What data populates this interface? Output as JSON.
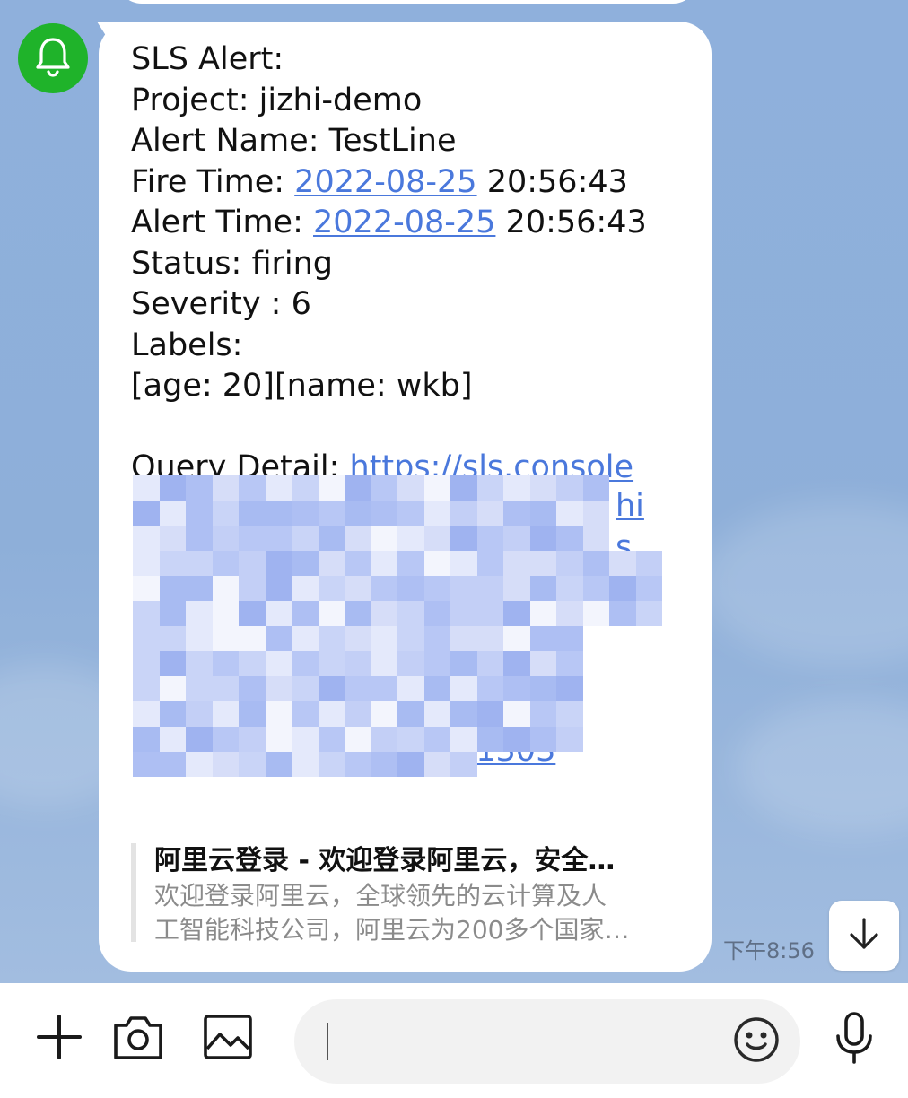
{
  "message": {
    "lines": [
      {
        "text": "SLS Alert:"
      },
      {
        "text": "Project: jizhi-demo"
      },
      {
        "text": "Alert Name: TestLine"
      },
      {
        "prefix": "Fire Time: ",
        "link": "2022-08-25",
        "suffix": " 20:56:43"
      },
      {
        "prefix": "Alert Time: ",
        "link": "2022-08-25",
        "suffix": " 20:56:43"
      },
      {
        "text": "Status: firing"
      },
      {
        "text": "Severity : 6"
      },
      {
        "text": "Labels:"
      },
      {
        "text": "[age: 20][name: wkb]"
      },
      {
        "text": ""
      },
      {
        "prefix": "Query Detail: ",
        "link": "https://sls.console"
      }
    ],
    "url_fragments": [
      "hi",
      "s",
      "e",
      "31303"
    ]
  },
  "link_preview": {
    "title": "阿里云登录 - 欢迎登录阿里云，安全…",
    "description_line1": "欢迎登录阿里云，全球领先的云计算及人",
    "description_line2": "工智能科技公司，阿里云为200多个国家…"
  },
  "timestamp": "下午8:56",
  "icons": {
    "avatar": "bell-icon",
    "scroll": "arrow-down-icon",
    "add": "plus-icon",
    "camera": "camera-icon",
    "gallery": "image-icon",
    "emoji": "smiley-icon",
    "voice": "microphone-icon"
  },
  "colors": {
    "link": "#4a78dc",
    "avatar_bg": "#1fb32a",
    "chat_bg": "#8fb0dc"
  }
}
